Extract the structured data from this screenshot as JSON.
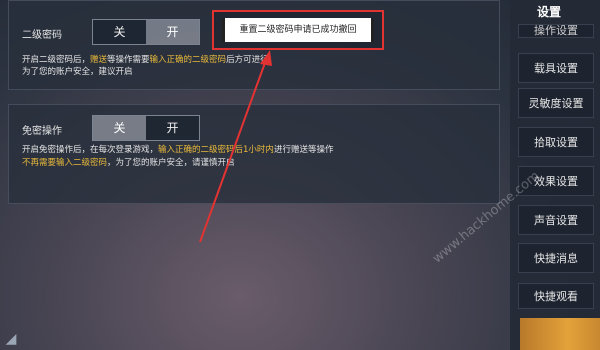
{
  "secondary_password": {
    "label": "二级密码",
    "toggle": {
      "off": "关",
      "on": "开",
      "selected": "开"
    },
    "desc_line1_a": "开启二级密码后，",
    "desc_line1_b": "赠送",
    "desc_line1_c": "等操作需要",
    "desc_line1_d": "输入正确的二级密码",
    "desc_line1_e": "后方可进行",
    "desc_line2": "为了您的账户安全，建议开启"
  },
  "password_free": {
    "label": "免密操作",
    "toggle": {
      "off": "关",
      "on": "开",
      "selected": "关"
    },
    "desc_line1_a": "开启免密操作后，在每次登录游戏，",
    "desc_line1_b": "输入正确的二级密码后1小时内",
    "desc_line1_c": "进行赠送等操作",
    "desc_line2_a": "不再需要输入二级密码",
    "desc_line2_b": "，为了您的账户安全，请谨慎开启"
  },
  "toast": {
    "message": "重置二级密码申请已成功撤回"
  },
  "sidebar": {
    "header": "设置",
    "items": [
      {
        "label": "操作设置"
      },
      {
        "label": "载具设置"
      },
      {
        "label": "灵敏度设置"
      },
      {
        "label": "拾取设置"
      },
      {
        "label": "效果设置"
      },
      {
        "label": "声音设置"
      },
      {
        "label": "快捷消息"
      },
      {
        "label": "快捷观看"
      }
    ]
  },
  "watermark": "www.hackhome.com",
  "colors": {
    "highlight": "#e8b93a",
    "annotation": "#e23333"
  }
}
